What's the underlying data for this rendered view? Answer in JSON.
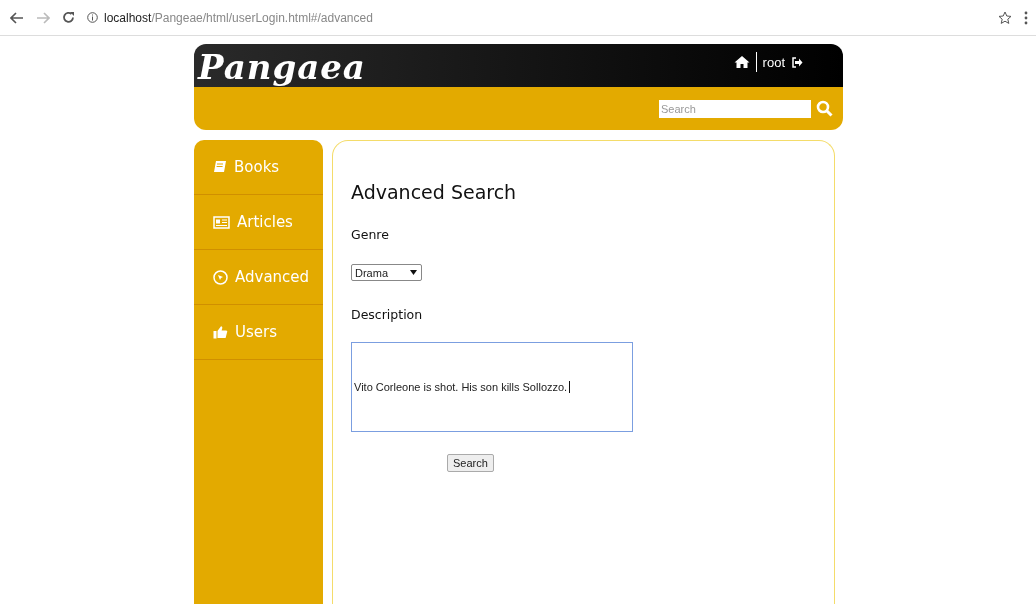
{
  "browser": {
    "url_host": "localhost",
    "url_path": "/Pangeae/html/userLogin.html#/advanced"
  },
  "header": {
    "logo": "Pangaea",
    "user": "root",
    "search": {
      "placeholder": "Search"
    }
  },
  "sidebar": {
    "items": [
      {
        "label": "Books"
      },
      {
        "label": "Articles"
      },
      {
        "label": "Advanced"
      },
      {
        "label": "Users"
      }
    ]
  },
  "main": {
    "title": "Advanced Search",
    "genre_label": "Genre",
    "genre_value": "Drama",
    "description_label": "Description",
    "description_value": "Vito Corleone is shot. His son kills Sollozzo.",
    "button": "Search"
  }
}
